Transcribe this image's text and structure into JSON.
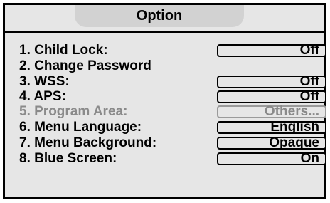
{
  "menu": {
    "title": "Option",
    "items": [
      {
        "label": "1. Child Lock:",
        "value": "Off"
      },
      {
        "label": "2. Change Password"
      },
      {
        "label": "3. WSS:",
        "value": "Off"
      },
      {
        "label": "4. APS:",
        "value": "Off"
      },
      {
        "label": "5. Program Area:",
        "value": "Others...",
        "disabled": true
      },
      {
        "label": "6. Menu Language:",
        "value": "English"
      },
      {
        "label": "7. Menu Background:",
        "value": "Opaque"
      },
      {
        "label": "8. Blue Screen:",
        "value": "On"
      }
    ]
  },
  "colors": {
    "background": "#e6e6e6",
    "title_tab": "#d2d2d2",
    "disabled_text": "#8a8a8a"
  }
}
